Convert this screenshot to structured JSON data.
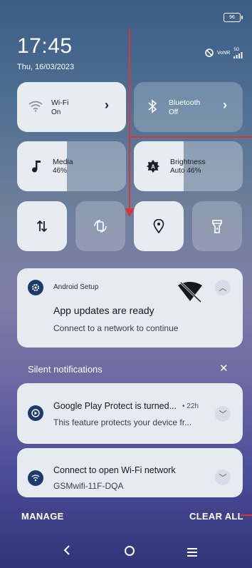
{
  "status_bar": {
    "battery": "96",
    "network": "5G",
    "network_labels": [
      "Vo",
      "NR"
    ]
  },
  "clock": {
    "time": "17:45",
    "date": "Thu, 16/03/2023"
  },
  "quick_settings": {
    "wifi": {
      "label": "Wi-Fi",
      "state": "On"
    },
    "bluetooth": {
      "label": "Bluetooth",
      "state": "Off"
    },
    "media": {
      "label": "Media",
      "value": "46%",
      "level": 0.46
    },
    "brightness": {
      "label": "Brightness",
      "value": "Auto 46%",
      "level": 0.46
    },
    "small_tiles": [
      {
        "icon": "data-transfer-icon",
        "active": true
      },
      {
        "icon": "auto-rotate-icon",
        "active": false
      },
      {
        "icon": "location-icon",
        "active": true
      },
      {
        "icon": "flashlight-icon",
        "active": false
      }
    ]
  },
  "notifications": {
    "android_setup": {
      "app": "Android Setup",
      "title": "App updates are ready",
      "body": "Connect to a network to continue"
    },
    "silent_header": "Silent notifications",
    "play_protect": {
      "title": "Google Play Protect is turned...",
      "time": "• 22h",
      "body": "This feature protects your device fr..."
    },
    "wifi_open": {
      "title": "Connect to open Wi-Fi network",
      "body": "GSMwifi-11F-DQA"
    }
  },
  "footer": {
    "manage": "MANAGE",
    "clear_all": "CLEAR ALL"
  },
  "colors": {
    "accent_dark": "#1e3a6a",
    "annotation_red": "#d7373a"
  }
}
